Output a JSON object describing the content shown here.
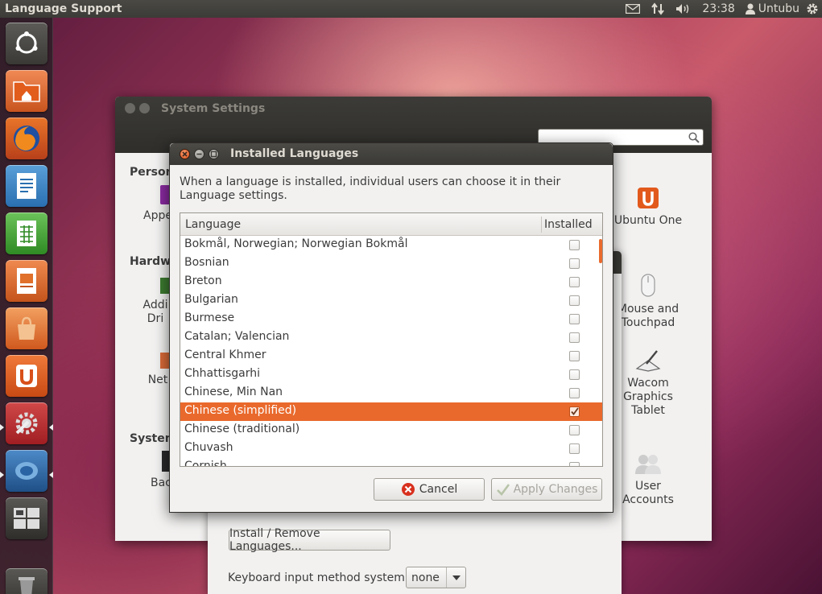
{
  "top_panel": {
    "app_title": "Language Support",
    "clock": "23:38",
    "user": "Untubu"
  },
  "launcher": {
    "items": [
      "dash-home",
      "home-folder",
      "firefox",
      "libreoffice-writer",
      "libreoffice-calc",
      "libreoffice-impress",
      "software-center",
      "ubuntu-one",
      "system-settings",
      "workspace-switcher-alt",
      "workspace-switcher",
      "trash"
    ]
  },
  "system_settings": {
    "title": "System Settings",
    "search_placeholder": "",
    "sections": {
      "personal": "Person",
      "hardware": "Hardwa",
      "system": "System"
    },
    "items": {
      "appearance": "Appe",
      "additional_drivers_1": "Addi",
      "additional_drivers_2": "Dri",
      "network": "Net",
      "backups": "Bac",
      "ubuntu_one": "Ubuntu One",
      "mouse_1": "Mouse and",
      "mouse_2": "Touchpad",
      "wacom_1": "Wacom",
      "wacom_2": "Graphics",
      "wacom_3": "Tablet",
      "user_accounts_1": "User",
      "user_accounts_2": "Accounts"
    }
  },
  "language_support": {
    "install_remove_button": "Install / Remove Languages...",
    "keyboard_input_label": "Keyboard input method system:",
    "keyboard_input_value": "none"
  },
  "installed_languages": {
    "title": "Installed Languages",
    "description": "When a language is installed, individual users can choose it in their Language settings.",
    "columns": {
      "language": "Language",
      "installed": "Installed"
    },
    "rows": [
      {
        "label": "Bokmål, Norwegian; Norwegian Bokmål",
        "installed": false
      },
      {
        "label": "Bosnian",
        "installed": false
      },
      {
        "label": "Breton",
        "installed": false
      },
      {
        "label": "Bulgarian",
        "installed": false
      },
      {
        "label": "Burmese",
        "installed": false
      },
      {
        "label": "Catalan; Valencian",
        "installed": false
      },
      {
        "label": "Central Khmer",
        "installed": false
      },
      {
        "label": "Chhattisgarhi",
        "installed": false
      },
      {
        "label": "Chinese, Min Nan",
        "installed": false
      },
      {
        "label": "Chinese (simplified)",
        "installed": true,
        "selected": true
      },
      {
        "label": "Chinese (traditional)",
        "installed": false
      },
      {
        "label": "Chuvash",
        "installed": false
      },
      {
        "label": "Cornish",
        "installed": false
      }
    ],
    "cancel_label": "Cancel",
    "apply_label": "Apply Changes"
  },
  "colors": {
    "selection": "#e9692c",
    "panel": "#3c3b37"
  }
}
